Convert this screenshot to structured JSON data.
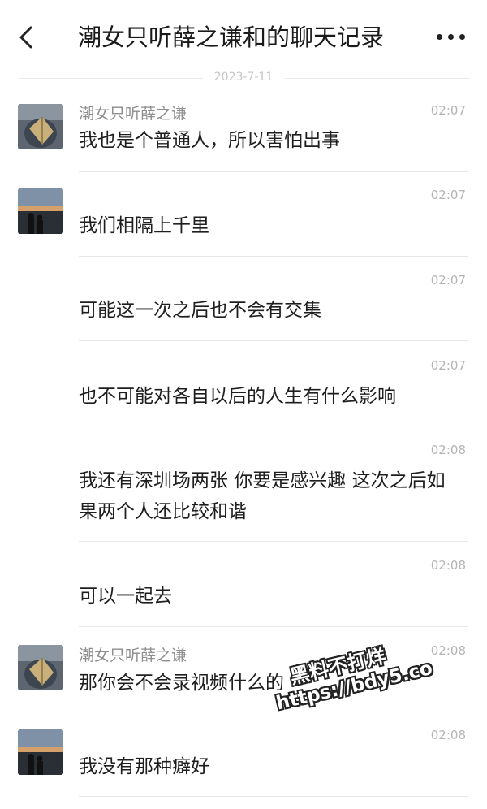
{
  "header": {
    "title": "潮女只听薛之谦和的聊天记录",
    "back_icon": "chevron-left-icon",
    "more_icon": "more-dots-icon"
  },
  "date_divider": "2023-7-11",
  "messages": [
    {
      "sender": "潮女只听薛之谦",
      "time": "02:07",
      "text": "我也是个普通人，所以害怕出事",
      "avatar": "avatar-a"
    },
    {
      "sender": "",
      "time": "02:07",
      "text": "我们相隔上千里",
      "avatar": "avatar-b"
    },
    {
      "sender": "",
      "time": "02:07",
      "text": "可能这一次之后也不会有交集",
      "avatar": ""
    },
    {
      "sender": "",
      "time": "02:07",
      "text": "也不可能对各自以后的人生有什么影响",
      "avatar": ""
    },
    {
      "sender": "",
      "time": "02:08",
      "text": "我还有深圳场两张 你要是感兴趣 这次之后如果两个人还比较和谐",
      "avatar": ""
    },
    {
      "sender": "",
      "time": "02:08",
      "text": "可以一起去",
      "avatar": ""
    },
    {
      "sender": "潮女只听薛之谦",
      "time": "02:08",
      "text": "那你会不会录视频什么的",
      "avatar": "avatar-a"
    },
    {
      "sender": "",
      "time": "02:08",
      "text": "我没有那种癖好",
      "avatar": "avatar-b"
    }
  ],
  "watermark": {
    "line1": "黑料不打烊",
    "line2": "https://bdy5.co"
  }
}
